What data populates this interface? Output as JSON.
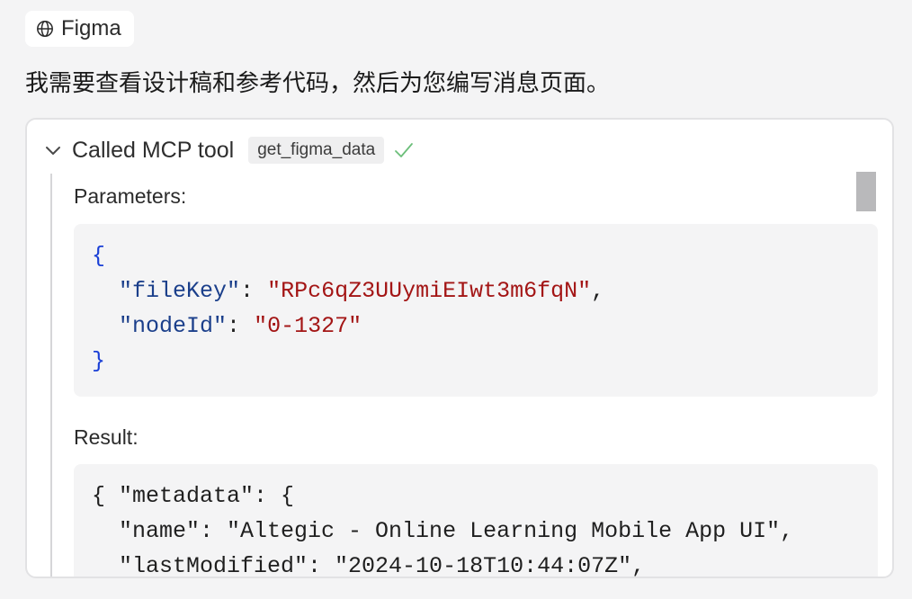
{
  "chip": {
    "icon": "globe-icon",
    "label": "Figma"
  },
  "message": "我需要查看设计稿和参考代码，然后为您编写消息页面。",
  "tool_card": {
    "title": "Called MCP tool",
    "tool_name": "get_figma_data",
    "status_icon": "checkmark-icon",
    "status_color": "#6cbf7a",
    "parameters_label": "Parameters:",
    "parameters": {
      "open": "{",
      "close": "}",
      "entries": [
        {
          "key": "\"fileKey\"",
          "value": "\"RPc6qZ3UUymiEIwt3m6fqN\"",
          "trail": ","
        },
        {
          "key": "\"nodeId\"",
          "value": "\"0-1327\"",
          "trail": ""
        }
      ]
    },
    "result_label": "Result:",
    "result_lines": [
      "{ \"metadata\": {",
      "  \"name\": \"Altegic - Online Learning Mobile App UI\",",
      "  \"lastModified\": \"2024-10-18T10:44:07Z\","
    ]
  }
}
